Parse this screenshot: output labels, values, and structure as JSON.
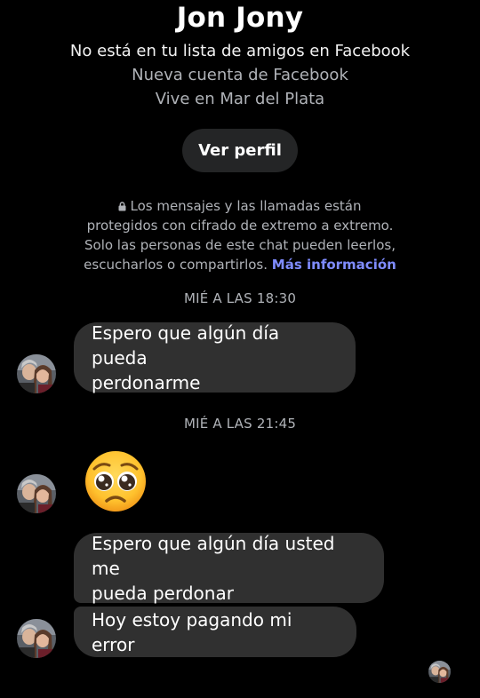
{
  "profile": {
    "name": "Jon Jony",
    "friend_status": "No está en tu lista de amigos en Facebook",
    "account_age": "Nueva cuenta de Facebook",
    "location": "Vive en Mar del Plata",
    "view_profile_label": "Ver perfil"
  },
  "encryption": {
    "icon": "lock-icon",
    "line1": "Los mensajes y las llamadas están",
    "line2": "protegidos con cifrado de extremo a extremo.",
    "line3": "Solo las personas de este chat pueden leerlos,",
    "line4": "escucharlos o compartirlos.",
    "link_label": "Más información",
    "link_color": "#7f8cff"
  },
  "conversation": {
    "timestamps": [
      "MIÉ A LAS 18:30",
      "MIÉ A LAS 21:45"
    ],
    "messages": [
      {
        "type": "text",
        "line1": "Espero que algún día pueda",
        "line2": "perdonarme"
      },
      {
        "type": "emoji",
        "icon": "pleading-face-emoji"
      },
      {
        "type": "text",
        "line1": "Espero que algún día usted me",
        "line2": "pueda perdonar"
      },
      {
        "type": "text",
        "line1": "Hoy estoy pagando mi error"
      }
    ]
  },
  "colors": {
    "background": "#000000",
    "bubble": "#303030",
    "secondary_text": "#b0b3b8",
    "button": "#242526"
  }
}
